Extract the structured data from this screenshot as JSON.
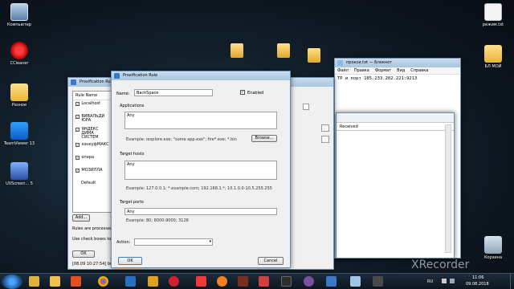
{
  "desktop_icons": [
    {
      "label": "Компьютер",
      "icon": "computer-icon"
    },
    {
      "label": "CCleaner",
      "icon": "ccleaner-icon"
    },
    {
      "label": "Разное",
      "icon": "folder-icon"
    },
    {
      "label": "TeamViewer 13",
      "icon": "teamviewer-icon"
    },
    {
      "label": "UVScreen... 5",
      "icon": "uvscreen-icon"
    },
    {
      "label": "режим.txt",
      "icon": "text-file-icon"
    },
    {
      "label": "БЛ МОЙ",
      "icon": "folder-icon"
    },
    {
      "label": "Корзина",
      "icon": "recycle-bin-icon"
    }
  ],
  "back_window": {
    "title": "Proxification Rule",
    "column_header": "Rule Name",
    "rules": [
      {
        "name": "Localhost",
        "checked": true
      },
      {
        "name": "ВИВАЛЬДИ ЮРА",
        "checked": true
      },
      {
        "name": "ЯНДЕКС ДИМА СИСТЕМ",
        "checked": true
      },
      {
        "name": "хонкуфМАКС",
        "checked": true
      },
      {
        "name": "опера",
        "checked": true
      },
      {
        "name": "МОЗИЛЛА",
        "checked": true
      },
      {
        "name": "Default",
        "checked": false
      }
    ],
    "add_button": "Add...",
    "status_line1": "Rules are processed",
    "status_line2": "Use check boxes to e",
    "ok_button": "OK",
    "log_line": "[08.09 10:27:54] browse"
  },
  "dialog": {
    "title": "Proxification Rule",
    "name_label": "Name:",
    "name_value": "BackSpace",
    "enabled_label": "Enabled",
    "enabled_checked": true,
    "applications_label": "Applications",
    "applications_value": "Any",
    "applications_example": "Example: iexplore.exe; \"some app.exe\"; fire*.exe; *.bin",
    "browse_button": "Browse...",
    "target_hosts_label": "Target hosts",
    "target_hosts_value": "Any",
    "target_hosts_example": "Example: 127.0.0.1; *.example.com; 192.168.1.*; 10.1.0.0-10.5.255.255",
    "target_ports_label": "Target ports",
    "target_ports_value": "Any",
    "target_ports_example": "Example: 80; 8000-9000; 3128",
    "action_label": "Action:",
    "ok_button": "OK",
    "cancel_button": "Cancel"
  },
  "notepad": {
    "title": "прокси.txt — Блокнот",
    "menu": [
      "Файл",
      "Правка",
      "Формат",
      "Вид",
      "Справка"
    ],
    "content": "TP и порт 185.233.202.221:9213"
  },
  "right_panel": {
    "column_received": "Received"
  },
  "taskbar": {
    "language": "RU",
    "time": "11:06",
    "date": "09.08.2018"
  },
  "watermark": "XRecorder"
}
